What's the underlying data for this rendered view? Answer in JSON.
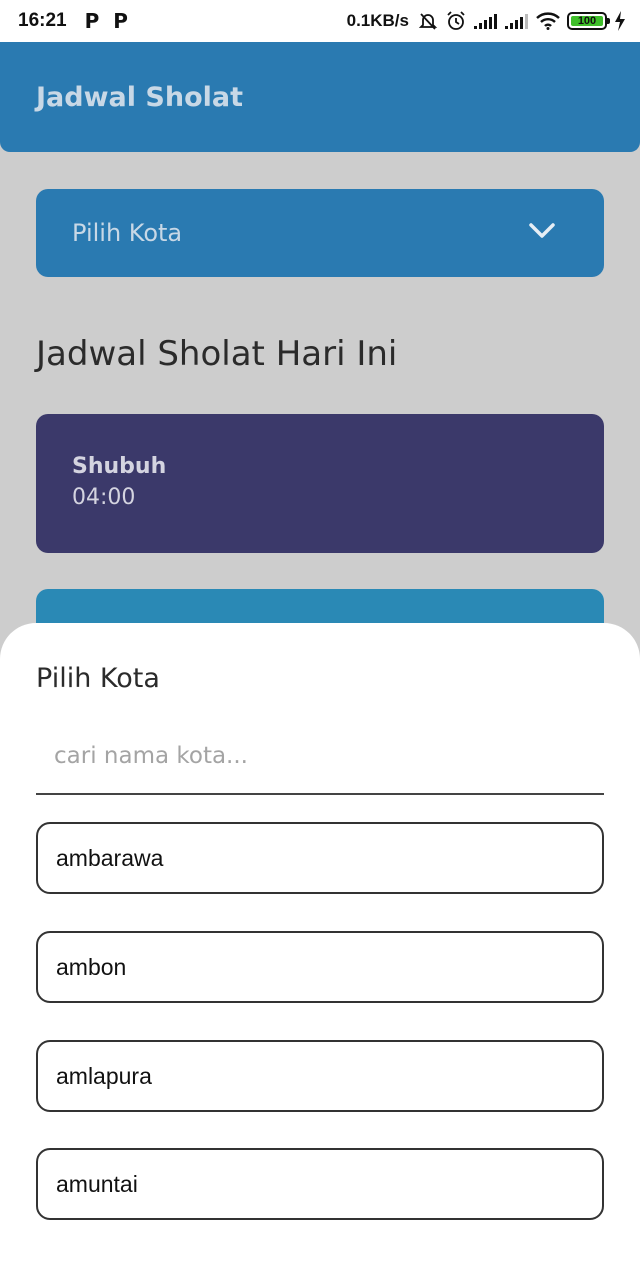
{
  "status_bar": {
    "time": "16:21",
    "notif1": "P",
    "notif2": "P",
    "speed": "0.1KB/s",
    "battery": "100",
    "battery_color": "#3fbf2a"
  },
  "app_bar": {
    "title": "Jadwal Sholat",
    "color": "#2a7ab1"
  },
  "city_select": {
    "label": "Pilih Kota",
    "icon": "chevron-down-icon"
  },
  "section": {
    "title": "Jadwal Sholat Hari Ini"
  },
  "prayers": [
    {
      "name": "Shubuh",
      "time": "04:00",
      "color": "#3b396a"
    },
    {
      "color": "#2a89b5"
    }
  ],
  "sheet": {
    "title": "Pilih Kota",
    "search_placeholder": "cari nama kota...",
    "cities": [
      "ambarawa",
      "ambon",
      "amlapura",
      "amuntai"
    ]
  }
}
